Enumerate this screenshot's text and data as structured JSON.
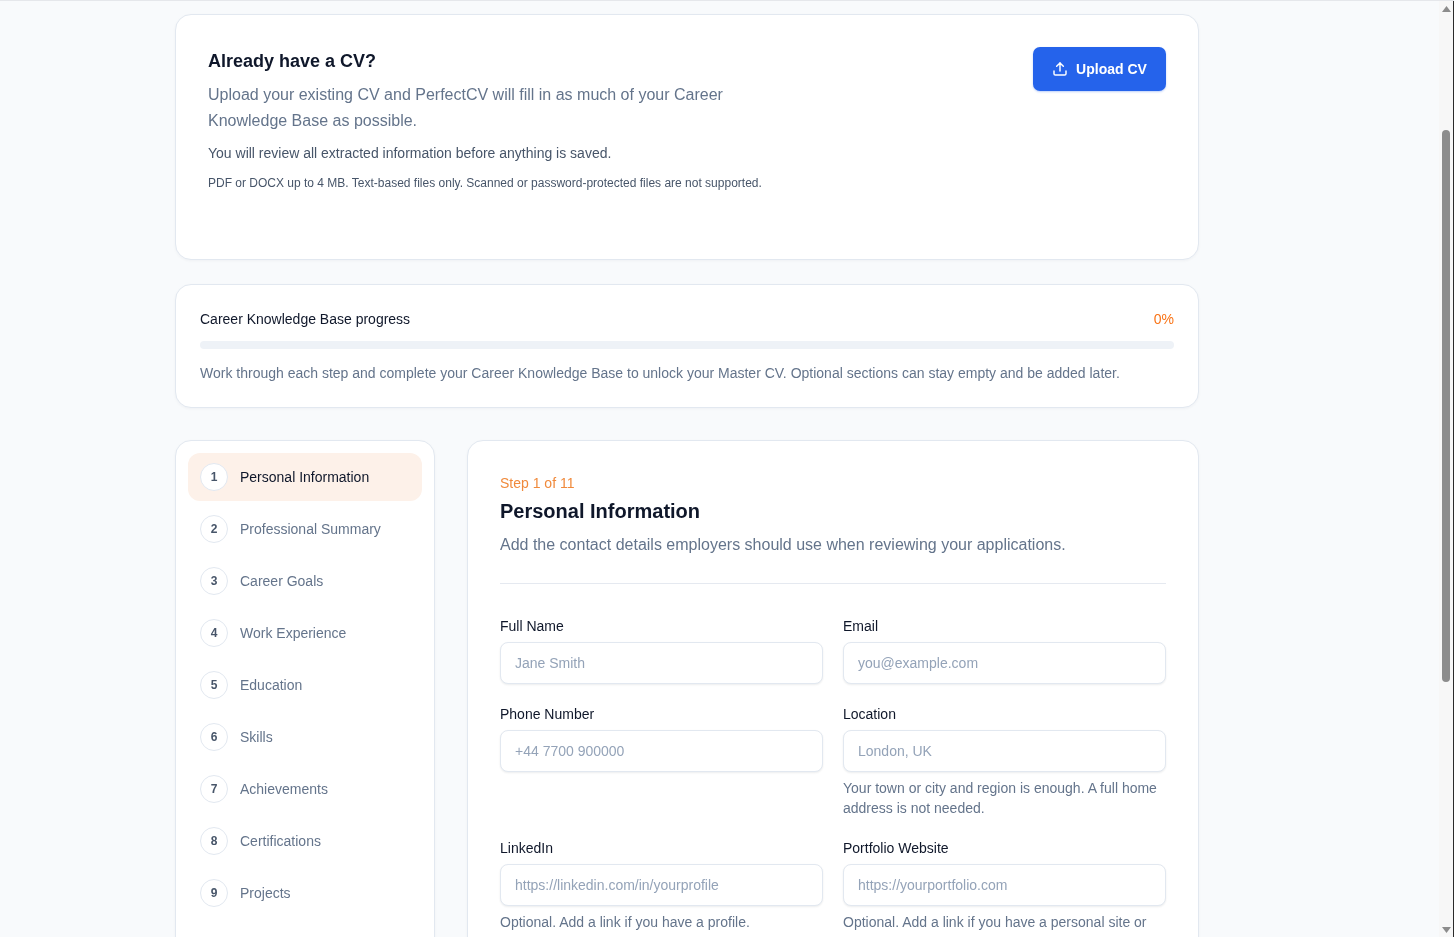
{
  "upload_card": {
    "title": "Already have a CV?",
    "description": "Upload your existing CV and PerfectCV will fill in as much of your Career Knowledge Base as possible.",
    "note": "You will review all extracted information before anything is saved.",
    "file_hint": "PDF or DOCX up to 4 MB. Text-based files only. Scanned or password-protected files are not supported.",
    "button": "Upload CV"
  },
  "progress": {
    "title": "Career Knowledge Base progress",
    "percent": "0%",
    "level": 0,
    "description": "Work through each step and complete your Career Knowledge Base to unlock your Master CV. Optional sections can stay empty and be added later."
  },
  "steps": [
    {
      "number": "1",
      "label": "Personal Information",
      "selected": true
    },
    {
      "number": "2",
      "label": "Professional Summary",
      "selected": false
    },
    {
      "number": "3",
      "label": "Career Goals",
      "selected": false
    },
    {
      "number": "4",
      "label": "Work Experience",
      "selected": false
    },
    {
      "number": "5",
      "label": "Education",
      "selected": false
    },
    {
      "number": "6",
      "label": "Skills",
      "selected": false
    },
    {
      "number": "7",
      "label": "Achievements",
      "selected": false
    },
    {
      "number": "8",
      "label": "Certifications",
      "selected": false
    },
    {
      "number": "9",
      "label": "Projects",
      "selected": false
    }
  ],
  "form": {
    "step_label": "Step 1 of 11",
    "title": "Personal Information",
    "description": "Add the contact details employers should use when reviewing your applications.",
    "fields": [
      {
        "label": "Full Name",
        "placeholder": "Jane Smith"
      },
      {
        "label": "Email",
        "placeholder": "you@example.com"
      },
      {
        "label": "Phone Number",
        "placeholder": "+44 7700 900000"
      },
      {
        "label": "Location",
        "placeholder": "London, UK",
        "help": "Your town or city and region is enough. A full home address is not needed."
      },
      {
        "label": "LinkedIn",
        "placeholder": "https://linkedin.com/in/yourprofile",
        "help": "Optional. Add a link if you have a profile."
      },
      {
        "label": "Portfolio Website",
        "placeholder": "https://yourportfolio.com",
        "help": "Optional. Add a link if you have a personal site or"
      }
    ]
  }
}
